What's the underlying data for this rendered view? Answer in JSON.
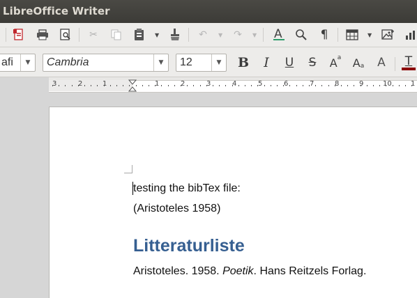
{
  "window": {
    "title": "LibreOffice Writer"
  },
  "toolbar": {
    "standard_icons": [
      "export-pdf-icon",
      "print-icon",
      "print-preview-icon",
      "cut-icon",
      "copy-icon",
      "paste-icon",
      "clone-formatting-icon",
      "undo-icon",
      "redo-icon",
      "find-replace-icon",
      "zoom-icon",
      "formatting-marks-icon",
      "insert-table-icon",
      "insert-image-icon"
    ],
    "paragraph_style": "afi",
    "font_name": "Cambria",
    "font_size": "12",
    "bold_label": "B",
    "italic_label": "I",
    "underline_label": "U",
    "strikethrough_label": "S",
    "superscript_label": "A",
    "subscript_label": "A",
    "shadow_label": "A",
    "font_color_label": "T",
    "font_color": "#8b0000"
  },
  "ruler": {
    "labels": [
      "3",
      "2",
      "1",
      "1",
      "2",
      "3",
      "4",
      "5",
      "6",
      "7",
      "8",
      "9",
      "10",
      "1"
    ]
  },
  "document": {
    "lines": [
      "testing the bibTex file:",
      "(Aristoteles 1958)"
    ],
    "heading": "Litteraturliste",
    "bibliography": {
      "before": "Aristoteles. 1958. ",
      "title": "Poetik",
      "after": ". Hans Reitzels Forlag."
    }
  },
  "colors": {
    "heading": "#365f91",
    "titlebar": "#3c3b37"
  }
}
